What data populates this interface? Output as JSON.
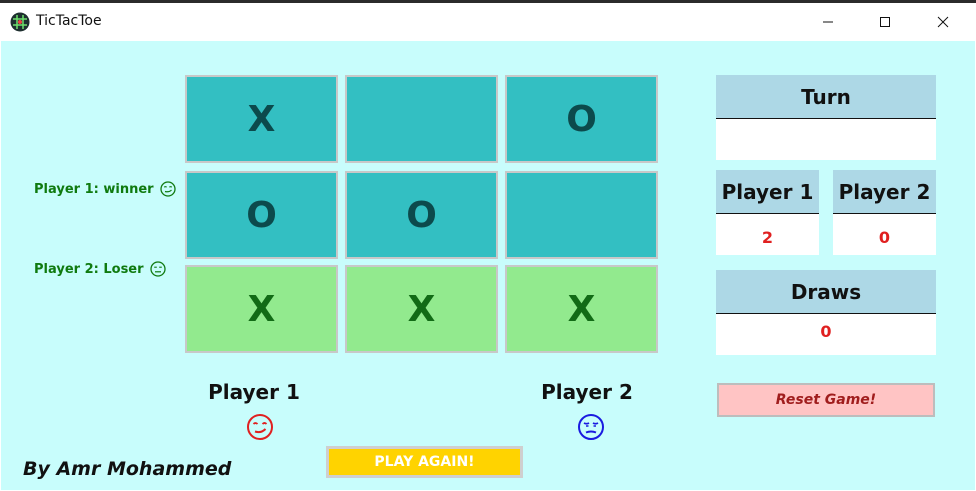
{
  "window": {
    "title": "TicTacToe",
    "controls": [
      "minimize-icon",
      "maximize-icon",
      "close-icon"
    ]
  },
  "board": {
    "cells": [
      "X",
      "",
      "O",
      "O",
      "O",
      "",
      "X",
      "X",
      "X"
    ],
    "winning_cells": [
      6,
      7,
      8
    ]
  },
  "side_labels": {
    "player1": "Player 1: winner",
    "player2": "Player 2: Loser"
  },
  "players": {
    "p1_name": "Player 1",
    "p2_name": "Player 2",
    "p1_icon": "smirk-face-icon",
    "p2_icon": "unamused-face-icon"
  },
  "scoreboard": {
    "turn_label": "Turn",
    "turn_value": "",
    "p1_label": "Player 1",
    "p1_score": "2",
    "p2_label": "Player 2",
    "p2_score": "0",
    "draws_label": "Draws",
    "draws_value": "0"
  },
  "buttons": {
    "reset": "Reset Game!",
    "play_again": "PLAY AGAIN!"
  },
  "author": "By Amr Mohammed",
  "colors": {
    "background": "#c8fdfc",
    "cell": "#33bfc2",
    "winning_cell": "#92ea8e",
    "panel_header": "#add8e6",
    "score_red": "#e02020",
    "reset_bg": "#ffc4c4",
    "play_again_bg": "#ffd300",
    "winner_green": "#0f7a0f",
    "p1_face": "#e02020",
    "p2_face": "#1a1ae0"
  }
}
